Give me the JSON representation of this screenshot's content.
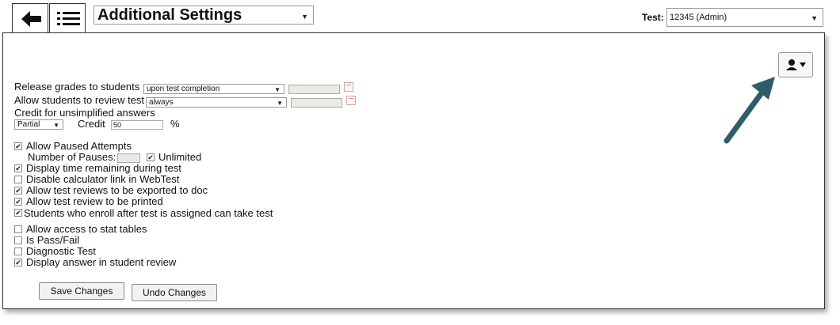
{
  "header": {
    "page_select_value": "Additional Settings",
    "test_label": "Test:",
    "test_select_value": "12345 (Admin)"
  },
  "settings": {
    "release_grades_label": "Release grades to students",
    "release_grades_value": "upon test completion",
    "allow_review_label": "Allow students to review test",
    "allow_review_value": "always",
    "credit_unsimplified_label": "Credit for unsimplified answers",
    "credit_type_value": "Partial",
    "credit_label": "Credit",
    "credit_value": "50",
    "percent_symbol": "%"
  },
  "checkboxes": [
    {
      "label": "Allow Paused Attempts",
      "checked": true
    },
    {
      "label": "Display time remaining during test",
      "checked": true
    },
    {
      "label": "Disable calculator link in WebTest",
      "checked": false
    },
    {
      "label": "Allow test reviews to be exported to doc",
      "checked": true
    },
    {
      "label": "Allow test review to be printed",
      "checked": true
    },
    {
      "label": "Students who enroll after test is assigned can take test",
      "checked": true
    },
    {
      "label": "Allow access to stat tables",
      "checked": false
    },
    {
      "label": "Is Pass/Fail",
      "checked": false
    },
    {
      "label": "Diagnostic Test",
      "checked": false
    },
    {
      "label": "Display answer in student review",
      "checked": true
    }
  ],
  "pauses": {
    "number_label": "Number of Pauses:",
    "unlimited_label": "Unlimited",
    "unlimited_checked": true
  },
  "buttons": {
    "save": "Save Changes",
    "undo": "Undo Changes"
  },
  "colors": {
    "annotation_arrow": "#2e5d6a"
  }
}
